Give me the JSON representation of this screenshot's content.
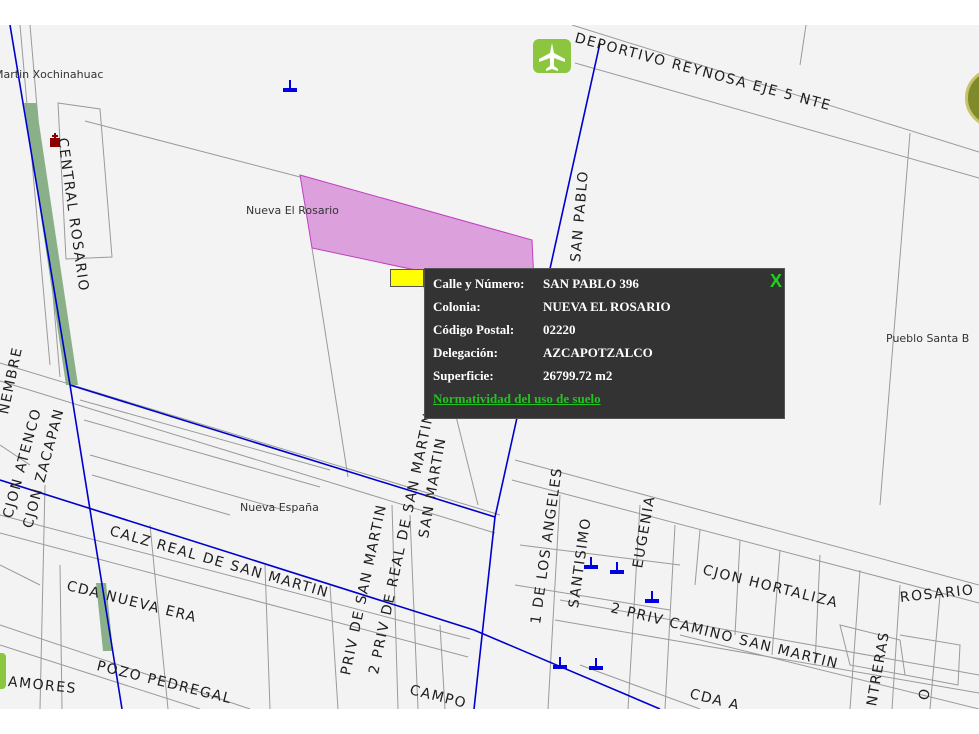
{
  "info_popup": {
    "rows": [
      {
        "label": "Calle y Número:",
        "value": "SAN PABLO 396"
      },
      {
        "label": "Colonia:",
        "value": "NUEVA EL ROSARIO"
      },
      {
        "label": "Código Postal:",
        "value": "02220"
      },
      {
        "label": "Delegación:",
        "value": "AZCAPOTZALCO"
      },
      {
        "label": "Superficie:",
        "value": "26799.72 m2"
      }
    ],
    "link_text": "Normatividad del uso de suelo",
    "close_label": "X"
  },
  "streets": {
    "deportivo": "DEPORTIVO REYNOSA EJE 5 NTE",
    "central_rosario": "CENTRAL ROSARIO",
    "san_pablo": "SAN PABLO",
    "calz_real": "CALZ REAL DE SAN MARTIN",
    "cda_nueva_era": "CDA NUEVA ERA",
    "pozo_pedregal": "POZO PEDREGAL",
    "amores": "AMORES",
    "cjon_zacapan": "CJON ZACAPAN",
    "cjon_atenco": "CJON ATENCO",
    "nembre": "NEMBRE",
    "priv_san_martin": "PRIV DE SAN MARTIN",
    "priv_real": "2 PRIV DE REAL DE SAN MARTIN",
    "san_martin": "SAN MARTIN",
    "campo": "CAMPO",
    "los_angeles": "1 DE LOS ANGELES",
    "santisimo": "SANTISIMO",
    "eugenia": "EUGENIA",
    "cjon_hortaliza": "CJON HORTALIZA",
    "rosario": "ROSARIO",
    "priv_camino": "2 PRIV CAMINO SAN MARTIN",
    "cda_a": "CDA A",
    "ntreras": "NTRERAS",
    "o": "O"
  },
  "neighborhoods": {
    "xochinahuac": "Martin Xochinahuac",
    "nueva_el_rosario": "Nueva El Rosario",
    "nueva_espana": "Nueva España",
    "pueblo_santa": "Pueblo Santa B"
  },
  "colors": {
    "parcel_fill": "#dca0dc",
    "parcel_stroke": "#c040c0",
    "route": "#0000cc",
    "rail": "#8ab08a",
    "marker": "#ffff00",
    "popup_bg": "#333333",
    "link": "#22c322"
  }
}
